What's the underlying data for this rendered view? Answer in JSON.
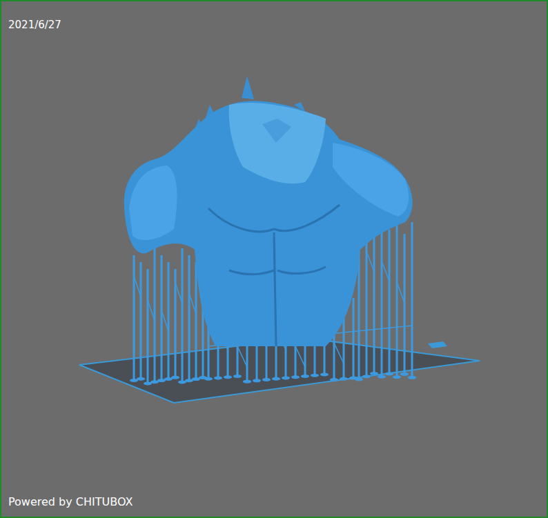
{
  "viewport": {
    "date": "2021/6/27",
    "watermark": "Powered by CHITUBOX"
  }
}
